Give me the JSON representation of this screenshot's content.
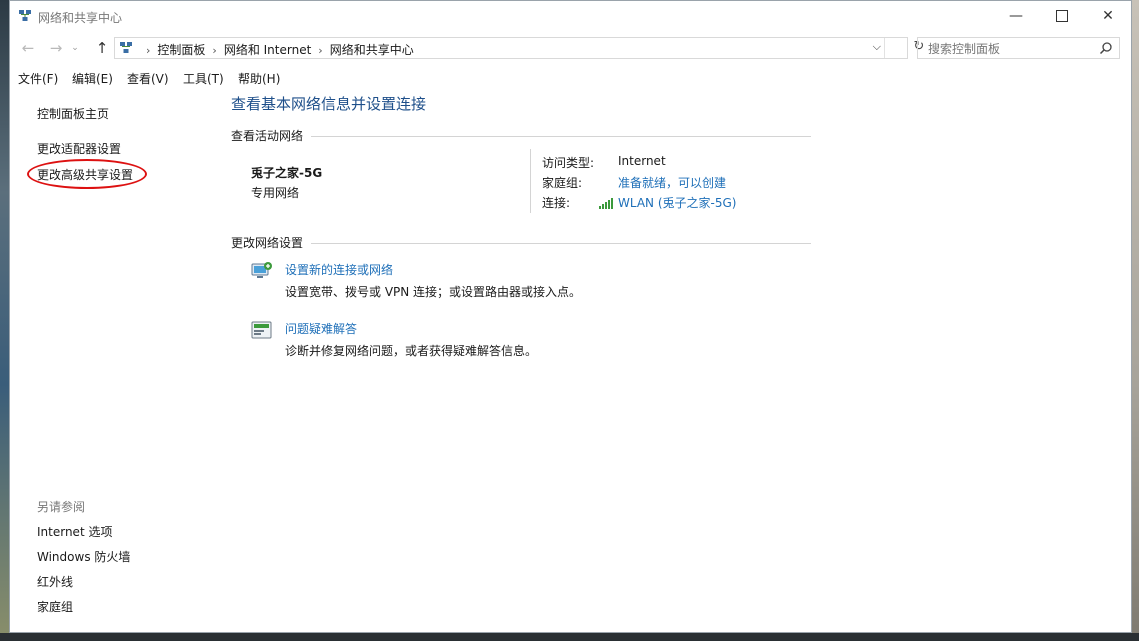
{
  "window": {
    "title": "网络和共享中心",
    "minimize_glyph": "—",
    "close_glyph": "✕"
  },
  "nav": {
    "back_glyph": "←",
    "forward_glyph": "→",
    "recent_glyph": "⌄",
    "up_glyph": "↑",
    "breadcrumbs": [
      "控制面板",
      "网络和 Internet",
      "网络和共享中心"
    ],
    "breadcrumb_separator": "›",
    "dropdown_glyph": "⌵",
    "refresh_glyph": "↻",
    "search_placeholder": "搜索控制面板"
  },
  "menu": [
    "文件(F)",
    "编辑(E)",
    "查看(V)",
    "工具(T)",
    "帮助(H)"
  ],
  "left_panel": {
    "links": [
      "控制面板主页",
      "更改适配器设置",
      "更改高级共享设置"
    ],
    "see_also_heading": "另请参阅",
    "see_also": [
      "Internet 选项",
      "Windows 防火墙",
      "红外线",
      "家庭组"
    ]
  },
  "main": {
    "title": "查看基本网络信息并设置连接",
    "active_networks_heading": "查看活动网络",
    "network": {
      "name": "兎子之家-5G",
      "type": "专用网络",
      "access_type_label": "访问类型:",
      "access_type_value": "Internet",
      "homegroup_label": "家庭组:",
      "homegroup_value": "准备就绪，可以创建",
      "connection_label": "连接:",
      "connection_value": "WLAN (兎子之家-5G)"
    },
    "change_settings_heading": "更改网络设置",
    "tasks": [
      {
        "title": "设置新的连接或网络",
        "desc": "设置宽带、拨号或 VPN 连接；或设置路由器或接入点。",
        "icon": "network-setup-icon"
      },
      {
        "title": "问题疑难解答",
        "desc": "诊断并修复网络问题，或者获得疑难解答信息。",
        "icon": "troubleshoot-icon"
      }
    ]
  },
  "colors": {
    "link": "#1e6fb8",
    "title": "#1e4f8a",
    "annotation": "#dd1111"
  }
}
